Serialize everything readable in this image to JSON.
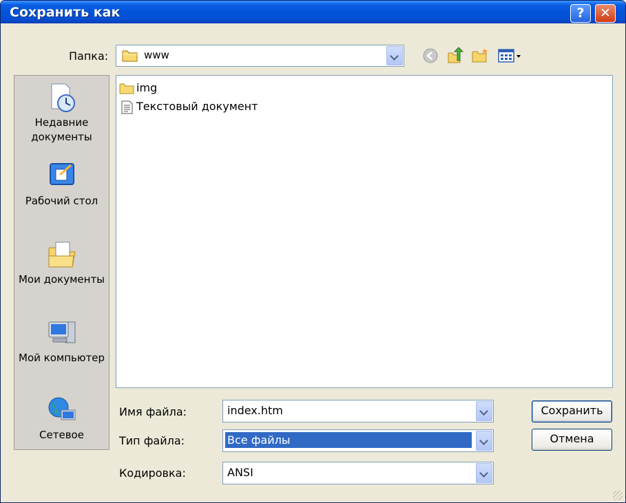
{
  "window": {
    "title": "Сохранить как",
    "help_label": "?",
    "close_label": "✕"
  },
  "toolbar": {
    "folder_label": "Папка:",
    "folder_value": "www",
    "buttons": [
      "back-icon",
      "up-folder-icon",
      "new-folder-icon",
      "view-menu-icon"
    ]
  },
  "places": [
    {
      "label": "Недавние документы",
      "icon": "recent-documents-icon"
    },
    {
      "label": "Рабочий стол",
      "icon": "desktop-icon"
    },
    {
      "label": "Мои документы",
      "icon": "my-documents-icon"
    },
    {
      "label": "Мой компьютер",
      "icon": "my-computer-icon"
    },
    {
      "label": "Сетевое",
      "icon": "network-icon"
    }
  ],
  "files": [
    {
      "name": "img",
      "icon": "folder-icon"
    },
    {
      "name": "Текстовый документ",
      "icon": "text-document-icon"
    }
  ],
  "form": {
    "filename_label": "Имя файла:",
    "filename_value": "index.htm",
    "filetype_label": "Тип файла:",
    "filetype_value": "Все файлы",
    "encoding_label": "Кодировка:",
    "encoding_value": "ANSI"
  },
  "buttons": {
    "save": "Сохранить",
    "cancel": "Отмена"
  },
  "colors": {
    "titlebar": "#0453d8",
    "dialog": "#ece9d8",
    "selection": "#316ac5",
    "border": "#7f9db9"
  }
}
